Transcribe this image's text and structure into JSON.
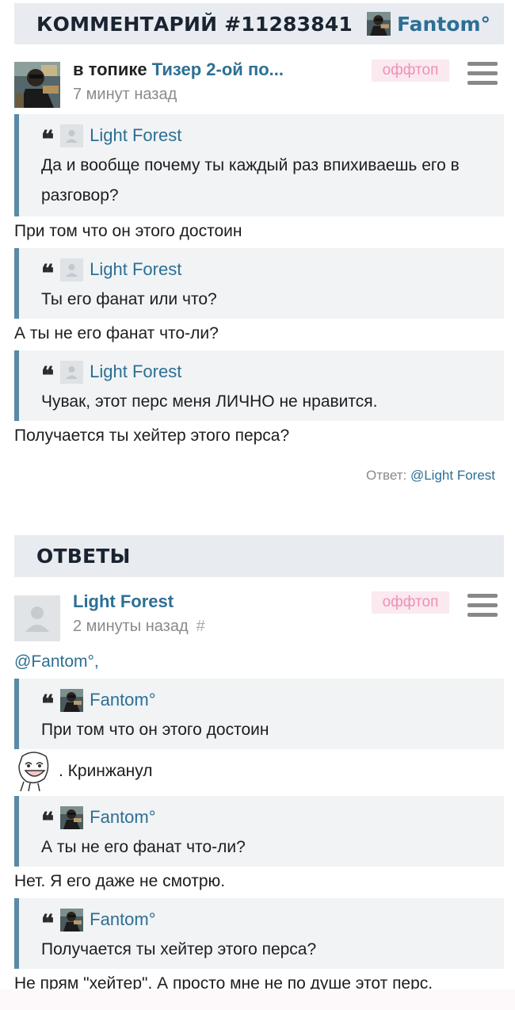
{
  "comment_header": {
    "title": "КОММЕНТАРИЙ #11283841",
    "author": "Fantom°",
    "author_avatar": "cyberpunk-avatar"
  },
  "comment_meta": {
    "topic_prefix": "в топике",
    "topic_title": "Тизер 2-ой по...",
    "time": "7 минут назад",
    "tag": "оффтоп",
    "menu_icon": "hamburger-icon"
  },
  "comment_body": [
    {
      "type": "quote",
      "author": "Light Forest",
      "text": "Да и вообще почему ты каждый раз впихиваешь его в разговор?"
    },
    {
      "type": "text",
      "text": "При том что он этого достоин"
    },
    {
      "type": "quote",
      "author": "Light Forest",
      "text": "Ты его фанат или что?"
    },
    {
      "type": "text",
      "text": "А ты не его фанат что-ли?"
    },
    {
      "type": "quote",
      "author": "Light Forest",
      "text": "Чувак, этот перс меня ЛИЧНО не нравится."
    },
    {
      "type": "text",
      "text": "Получается ты хейтер этого перса?"
    }
  ],
  "reply_to": {
    "label": "Ответ:",
    "target": "@Light Forest"
  },
  "replies_header": {
    "title": "ОТВЕТЫ"
  },
  "reply": {
    "author": "Light Forest",
    "time": "2 минуты назад",
    "hash": "#",
    "tag": "оффтоп",
    "mention": "@Fantom°,",
    "body": [
      {
        "type": "quote",
        "author": "Fantom°",
        "text": "При том что он этого достоин"
      },
      {
        "type": "emoji-text",
        "emoji": "troll-face-emoji",
        "text": ". Кринжанул"
      },
      {
        "type": "quote",
        "author": "Fantom°",
        "text": "А ты не его фанат что-ли?"
      },
      {
        "type": "text",
        "text": "Нет. Я его даже не смотрю."
      },
      {
        "type": "quote",
        "author": "Fantom°",
        "text": "Получается ты хейтер этого перса?"
      },
      {
        "type": "text",
        "text": "Не прям \"хейтер\". А просто мне не по душе этот перс."
      }
    ]
  },
  "colors": {
    "link": "#2d6f94",
    "header_bg": "#e8ecf1",
    "quote_bg": "#f1f3f5",
    "quote_border": "#5a8aa5",
    "offtop_bg": "#fbe9f0",
    "offtop_text": "#f08fb5"
  }
}
